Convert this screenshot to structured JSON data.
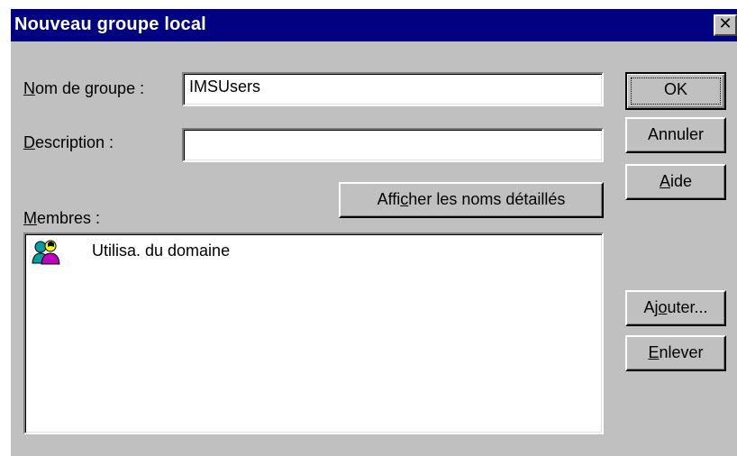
{
  "window": {
    "title": "Nouveau groupe local",
    "close_glyph": "✕"
  },
  "form": {
    "group_name_label_accel": "N",
    "group_name_label_rest": "om de groupe :",
    "group_name_value": "IMSUsers",
    "description_label_accel": "D",
    "description_label_rest": "escription :",
    "description_value": "",
    "members_label_accel": "M",
    "members_label_rest": "embres :"
  },
  "buttons": {
    "ok": "OK",
    "cancel": "Annuler",
    "help_accel": "A",
    "help_rest": "ide",
    "show_full_names_pre": "Affi",
    "show_full_names_accel": "c",
    "show_full_names_post": "her les noms détaillés",
    "add_pre": "Aj",
    "add_accel": "o",
    "add_post": "uter...",
    "remove_accel": "E",
    "remove_rest": "nlever"
  },
  "members": [
    {
      "icon": "domain-users-group-icon",
      "label": "Utilisa. du domaine"
    }
  ],
  "colors": {
    "titlebar": "#000080",
    "face": "#c0c0c0",
    "window": "#ffffff"
  }
}
